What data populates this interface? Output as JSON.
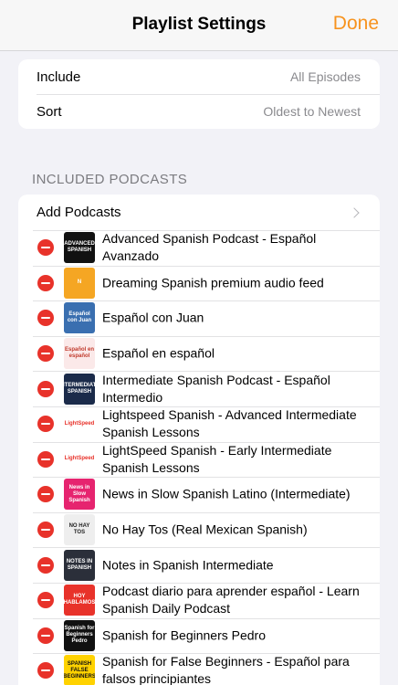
{
  "header": {
    "title": "Playlist Settings",
    "done_label": "Done"
  },
  "settings": {
    "include_label": "Include",
    "include_value": "All Episodes",
    "sort_label": "Sort",
    "sort_value": "Oldest to Newest"
  },
  "section_title": "INCLUDED PODCASTS",
  "add_podcasts_label": "Add Podcasts",
  "podcasts": [
    {
      "title": "Advanced Spanish Podcast - Español Avanzado",
      "art_text": "ADVANCED SPANISH",
      "art_bg": "#111111",
      "art_fg": "#ffffff"
    },
    {
      "title": "Dreaming Spanish premium audio feed",
      "art_text": "N",
      "art_bg": "#f5a623",
      "art_fg": "#ffffff"
    },
    {
      "title": "Español con Juan",
      "art_text": "Español con Juan",
      "art_bg": "#3a6fb0",
      "art_fg": "#ffffff"
    },
    {
      "title": "Español en español",
      "art_text": "Español en español",
      "art_bg": "#fbe9e9",
      "art_fg": "#c0392b"
    },
    {
      "title": "Intermediate Spanish Podcast - Español Intermedio",
      "art_text": "INTERMEDIATE SPANISH",
      "art_bg": "#1b2b4a",
      "art_fg": "#ffffff"
    },
    {
      "title": "Lightspeed Spanish - Advanced Intermediate Spanish Lessons",
      "art_text": "LightSpeed",
      "art_bg": "#ffffff",
      "art_fg": "#e8322a"
    },
    {
      "title": "LightSpeed Spanish - Early Intermediate Spanish Lessons",
      "art_text": "LightSpeed",
      "art_bg": "#ffffff",
      "art_fg": "#e8322a"
    },
    {
      "title": "News in Slow Spanish Latino (Intermediate)",
      "art_text": "News in Slow Spanish",
      "art_bg": "#e6246f",
      "art_fg": "#ffffff"
    },
    {
      "title": "No Hay Tos (Real Mexican Spanish)",
      "art_text": "NO HAY TOS",
      "art_bg": "#eeeeee",
      "art_fg": "#222222"
    },
    {
      "title": "Notes in Spanish Intermediate",
      "art_text": "NOTES IN SPANISH",
      "art_bg": "#2b2f3a",
      "art_fg": "#ffffff"
    },
    {
      "title": "Podcast diario para aprender español - Learn Spanish Daily Podcast",
      "art_text": "HOY HABLAMOS",
      "art_bg": "#e8322a",
      "art_fg": "#ffffff"
    },
    {
      "title": "Spanish for Beginners Pedro",
      "art_text": "Spanish for Beginners Pedro",
      "art_bg": "#111111",
      "art_fg": "#ffffff"
    },
    {
      "title": "Spanish for False Beginners - Español para falsos principiantes",
      "art_text": "SPANISH FALSE BEGINNERS",
      "art_bg": "#ffd200",
      "art_fg": "#111111"
    }
  ],
  "colors": {
    "accent": "#f7931e",
    "remove": "#e8322a"
  }
}
